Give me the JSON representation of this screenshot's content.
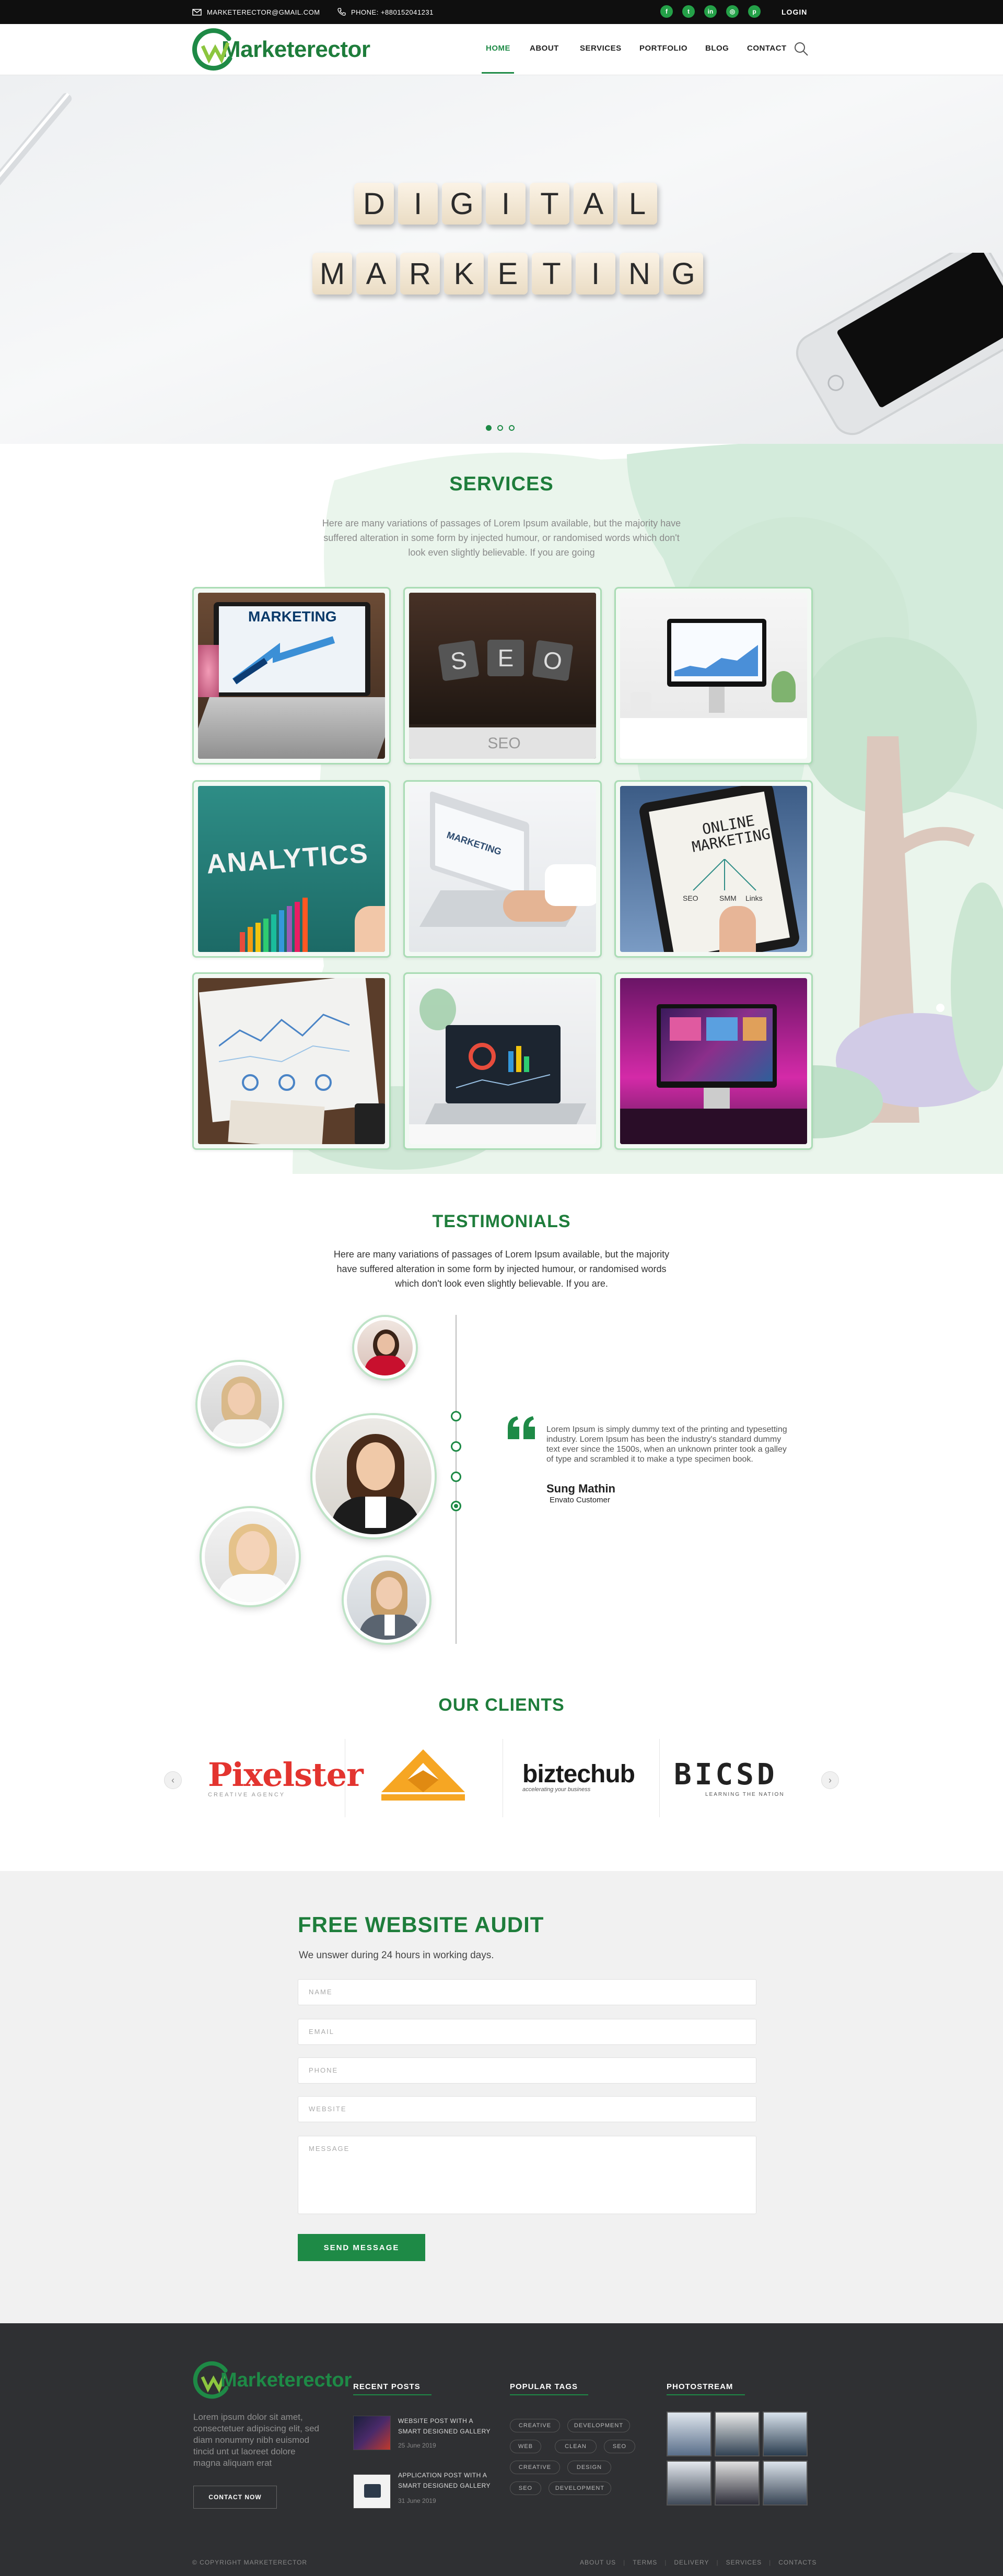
{
  "topbar": {
    "email": "MARKETERECTOR@GMAIL.COM",
    "phone": "PHONE: +880152041231",
    "social_icons": [
      "facebook-icon",
      "twitter-icon",
      "linkedin-icon",
      "instagram-icon",
      "pinterest-icon"
    ],
    "login": "LOGIN"
  },
  "header": {
    "logo_text": "Marketerector",
    "nav": [
      "HOME",
      "ABOUT",
      "SERVICES",
      "PORTFOLIO",
      "BLOG",
      "CONTACT"
    ],
    "active": "HOME"
  },
  "hero": {
    "line1": [
      "D",
      "I",
      "G",
      "I",
      "T",
      "A",
      "L"
    ],
    "line2": [
      "M",
      "A",
      "R",
      "K",
      "E",
      "T",
      "I",
      "N",
      "G"
    ],
    "slides": 3
  },
  "services": {
    "title": "SERVICES",
    "desc": "Here are many variations of passages of Lorem Ipsum available, but the majority have suffered alteration in some form by injected humour, or randomised words which don't look even slightly believable. If you are going",
    "cards": [
      {
        "name": "marketing-laptop",
        "caption": "MARKETING"
      },
      {
        "name": "seo-blocks",
        "caption": "SEO"
      },
      {
        "name": "desk-monitor",
        "caption": ""
      },
      {
        "name": "analytics-board",
        "caption": "ANALYTICS"
      },
      {
        "name": "typing-laptop",
        "caption": "MARKETING"
      },
      {
        "name": "online-marketing-tablet",
        "caption": "ONLINE MARKETING"
      },
      {
        "name": "report-papers",
        "caption": ""
      },
      {
        "name": "dashboard-laptop",
        "caption": ""
      },
      {
        "name": "neon-monitor",
        "caption": ""
      }
    ]
  },
  "testimonials": {
    "title": "TESTIMONIALS",
    "desc": "Here are many variations of passages of Lorem Ipsum available, but the majority have suffered alteration in some form by injected humour, or randomised words which don't look even slightly believable. If you are.",
    "quote": "Lorem Ipsum is simply dummy text of the printing and typesetting industry. Lorem Ipsum has been the industry's standard dummy text ever since the 1500s, when an unknown printer took a galley of type and scrambled it to make a type specimen book.",
    "author": "Sung Mathin",
    "role": "Envato Customer"
  },
  "clients": {
    "title": "OUR CLIENTS",
    "logos": [
      "Pixelster",
      "Triangle",
      "biztechub",
      "BICSD"
    ],
    "pixelster_tag": "CREATIVE AGENCY",
    "biztechub_tag": "accelerating your business",
    "bicsd_tag": "LEARNING THE NATION"
  },
  "audit": {
    "title": "FREE WEBSITE AUDIT",
    "subtitle": "We unswer during 24 hours in working days.",
    "fields": {
      "name": "NAME",
      "email": "EMAIL",
      "phone": "PHONE",
      "website": "WEBSITE",
      "message": "MESSAGE"
    },
    "button": "SEND MESSAGE"
  },
  "footer": {
    "logo_text": "Marketerector",
    "about": "Lorem ipsum dolor sit amet, consectetuer adipiscing elit, sed diam nonummy nibh euismod tincid unt ut laoreet dolore magna aliquam erat",
    "contact_button": "CONTACT NOW",
    "recent_posts_title": "RECENT POSTS",
    "posts": [
      {
        "title": "WEBSITE POST WITH A SMART DESIGNED GALLERY",
        "date": "25 June 2019"
      },
      {
        "title": "APPLICATION POST WITH A SMART DESIGNED GALLERY",
        "date": "31 June 2019"
      }
    ],
    "tags_title": "POPULAR TAGS",
    "tags": [
      "CREATIVE",
      "DEVELOPMENT",
      "WEB",
      "CLEAN",
      "SEO",
      "CREATIVE",
      "DESIGN",
      "SEO",
      "DEVELOPMENT"
    ],
    "photostream_title": "PHOTOSTREAM",
    "copyright": "© COPYRIGHT MARKETERECTOR",
    "links": [
      "ABOUT US",
      "TERMS",
      "DELIVERY",
      "SERVICES",
      "CONTACTS"
    ]
  },
  "colors": {
    "brand": "#1e8a46",
    "dark": "#0f0f0f",
    "footer": "#2f3033"
  }
}
